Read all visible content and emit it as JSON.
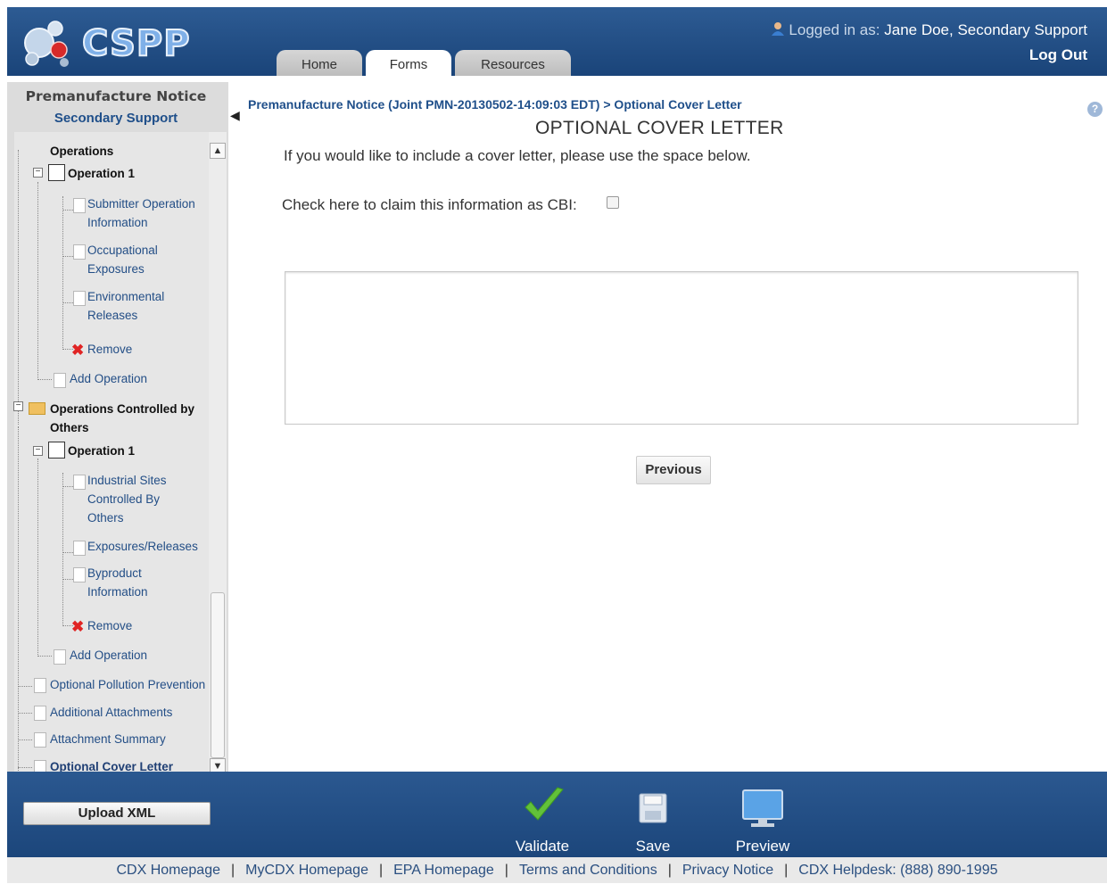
{
  "header": {
    "logo_text": "CSPP",
    "tabs": [
      "Home",
      "Forms",
      "Resources"
    ],
    "active_tab": "Forms",
    "logged_in_label": "Logged in as:",
    "user_name": "Jane Doe, Secondary Support",
    "logout_label": "Log Out"
  },
  "sidebar": {
    "title": "Premanufacture Notice",
    "role": "Secondary Support",
    "tree": {
      "operations": "Operations",
      "op1": "Operation 1",
      "submitter_1": "Submitter Operation",
      "submitter_2": "Information",
      "occupational_1": "Occupational",
      "occupational_2": "Exposures",
      "environmental_1": "Environmental",
      "environmental_2": "Releases",
      "remove": "Remove",
      "add_operation": "Add Operation",
      "ops_controlled_1": "Operations Controlled by",
      "ops_controlled_2": "Others",
      "op1b": "Operation 1",
      "industrial_1": "Industrial Sites",
      "industrial_2": "Controlled By",
      "industrial_3": "Others",
      "exposures_releases": "Exposures/Releases",
      "byproduct_1": "Byproduct",
      "byproduct_2": "Information",
      "remove_b": "Remove",
      "add_operation_b": "Add Operation",
      "optional_pollution": "Optional Pollution Prevention",
      "additional_attachments": "Additional Attachments",
      "attachment_summary": "Attachment Summary",
      "optional_cover_letter": "Optional Cover Letter"
    }
  },
  "main": {
    "breadcrumb": "Premanufacture Notice (Joint PMN-20130502-14:09:03 EDT) > Optional Cover Letter",
    "page_title": "OPTIONAL COVER LETTER",
    "instructions": "If you would like to include a cover letter, please use the space below.",
    "cbi_label": "Check here to claim this information as CBI:",
    "cbi_checked": false,
    "cover_letter_value": "",
    "previous_label": "Previous"
  },
  "bottom_bar": {
    "upload_label": "Upload XML",
    "validate_label": "Validate",
    "save_label": "Save",
    "preview_label": "Preview"
  },
  "footer": {
    "links": [
      "CDX Homepage",
      "MyCDX Homepage",
      "EPA Homepage",
      "Terms and Conditions",
      "Privacy Notice",
      "CDX Helpdesk: (888) 890-1995"
    ]
  },
  "colors": {
    "header_blue": "#1f4a80",
    "link_blue": "#1f4f8a",
    "validate_green": "#5cb82e",
    "remove_red": "#e02424"
  }
}
